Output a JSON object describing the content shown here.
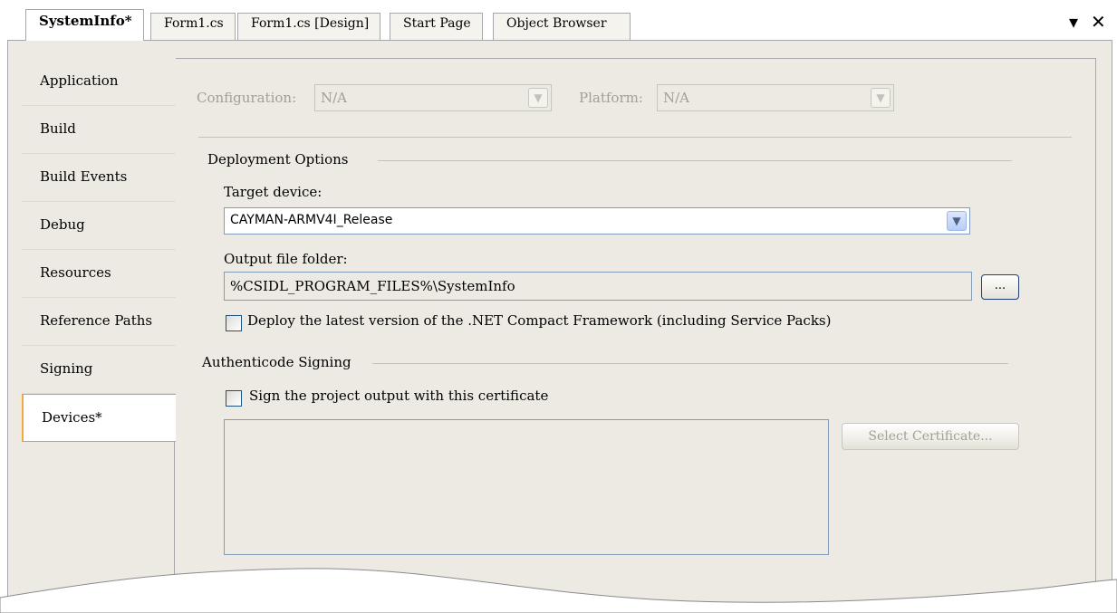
{
  "tabs": [
    {
      "label": "SystemInfo*",
      "active": true
    },
    {
      "label": "Form1.cs"
    },
    {
      "label": "Form1.cs [Design]"
    },
    {
      "label": "Start Page"
    },
    {
      "label": "Object Browser"
    }
  ],
  "window_controls": {
    "dropdown": "▾",
    "close": "✕"
  },
  "sidebar": {
    "items": [
      {
        "label": "Application"
      },
      {
        "label": "Build"
      },
      {
        "label": "Build Events"
      },
      {
        "label": "Debug"
      },
      {
        "label": "Resources"
      },
      {
        "label": "Reference Paths"
      },
      {
        "label": "Signing"
      },
      {
        "label": "Devices*",
        "active": true
      }
    ]
  },
  "config": {
    "configuration_label": "Configuration:",
    "configuration_value": "N/A",
    "platform_label": "Platform:",
    "platform_value": "N/A"
  },
  "deployment": {
    "section_title": "Deployment Options",
    "target_device_label": "Target device:",
    "target_device_value": "CAYMAN-ARMV4I_Release",
    "output_folder_label": "Output file folder:",
    "output_folder_value": "%CSIDL_PROGRAM_FILES%\\SystemInfo",
    "browse_label": "...",
    "deploy_cf_label": "Deploy the latest version of the .NET Compact Framework (including Service Packs)"
  },
  "signing": {
    "section_title": "Authenticode Signing",
    "sign_output_label": "Sign the project output with this certificate",
    "select_cert_label": "Select Certificate..."
  },
  "colors": {
    "panel_bg": "#eceae2",
    "border": "#a7a6aa",
    "active_tab_accent": "#f2a93b",
    "disabled_text": "#a2a194"
  }
}
